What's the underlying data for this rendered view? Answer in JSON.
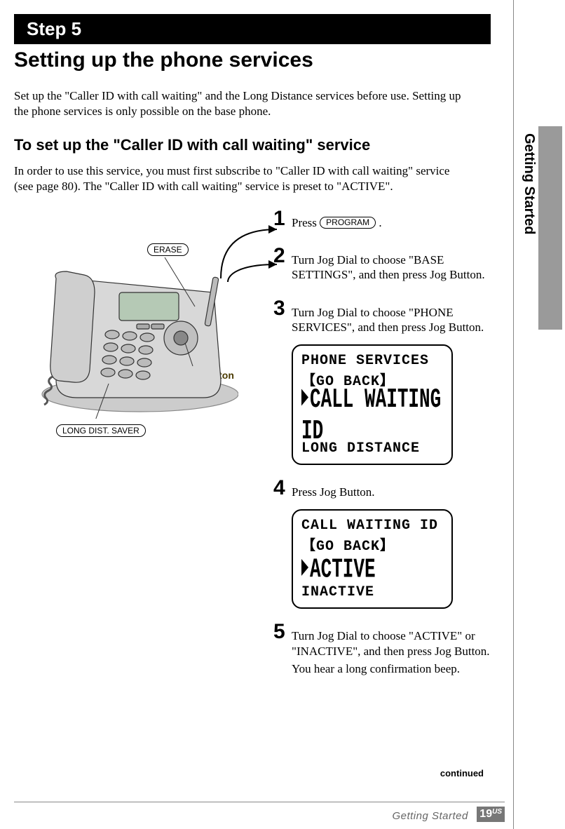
{
  "step_bar": "Step 5",
  "main_heading": "Setting up the phone services",
  "intro": "Set up the \"Caller ID with call waiting\" and the Long Distance services before use. Setting up the phone services is only possible on the base phone.",
  "sub_heading": "To set up the \"Caller ID with call waiting\" service",
  "sub_intro": "In order to use this service, you must first subscribe to \"Caller ID with call waiting\" service (see page 80). The \"Caller ID with call waiting\" service is preset to \"ACTIVE\".",
  "labels": {
    "erase": "ERASE",
    "long_dist": "LONG DIST. SAVER",
    "jog": "Jog Button",
    "program": "PROGRAM"
  },
  "steps": [
    {
      "n": "1",
      "text_before": "Press ",
      "pill": "PROGRAM",
      "text_after": "."
    },
    {
      "n": "2",
      "text": "Turn Jog Dial to choose \"BASE SETTINGS\", and then press Jog Button."
    },
    {
      "n": "3",
      "text": "Turn Jog Dial to choose \"PHONE  SERVICES\", and then press Jog Button.",
      "lcd": {
        "l1": "PHONE SERVICES",
        "l2": "【GO BACK】",
        "l3": "CALL WAITING ID",
        "l4": " LONG DISTANCE"
      }
    },
    {
      "n": "4",
      "text": "Press Jog Button.",
      "lcd": {
        "l1": "CALL WAITING ID",
        "l2": "【GO BACK】",
        "l3": "ACTIVE",
        "l4": " INACTIVE"
      }
    },
    {
      "n": "5",
      "text": "Turn Jog Dial to choose \"ACTIVE\" or \"INACTIVE\", and then press Jog Button.",
      "text2": "You hear a long confirmation beep."
    }
  ],
  "continued": "continued",
  "sidebar_tab": "Getting Started",
  "footer_section": "Getting Started",
  "page_number": "19",
  "page_region": "US"
}
